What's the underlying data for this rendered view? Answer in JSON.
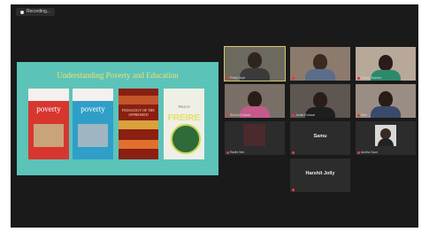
{
  "recording": {
    "label": "Recording..."
  },
  "shared_screen": {
    "slide_title": "Understanding Poverty and Education",
    "books": [
      {
        "title": "poverty"
      },
      {
        "title": "poverty"
      },
      {
        "title": "PEDAGOGY OF THE OPPRESSED"
      },
      {
        "title": "PAULO",
        "subtitle": "FREIRE"
      }
    ]
  },
  "participants": [
    {
      "name": "Philip Dept"
    },
    {
      "name": ""
    },
    {
      "name": "Ruchit Sharma"
    },
    {
      "name": "Shivani Kakkar"
    },
    {
      "name": "Jamie Konwar"
    },
    {
      "name": "Deb"
    },
    {
      "name": "Radhi Sen"
    },
    {
      "name": "Samu",
      "display": "Samu"
    },
    {
      "name": "Amrita Gaur"
    },
    {
      "name": "",
      "display": "Harshit Jolly"
    }
  ]
}
